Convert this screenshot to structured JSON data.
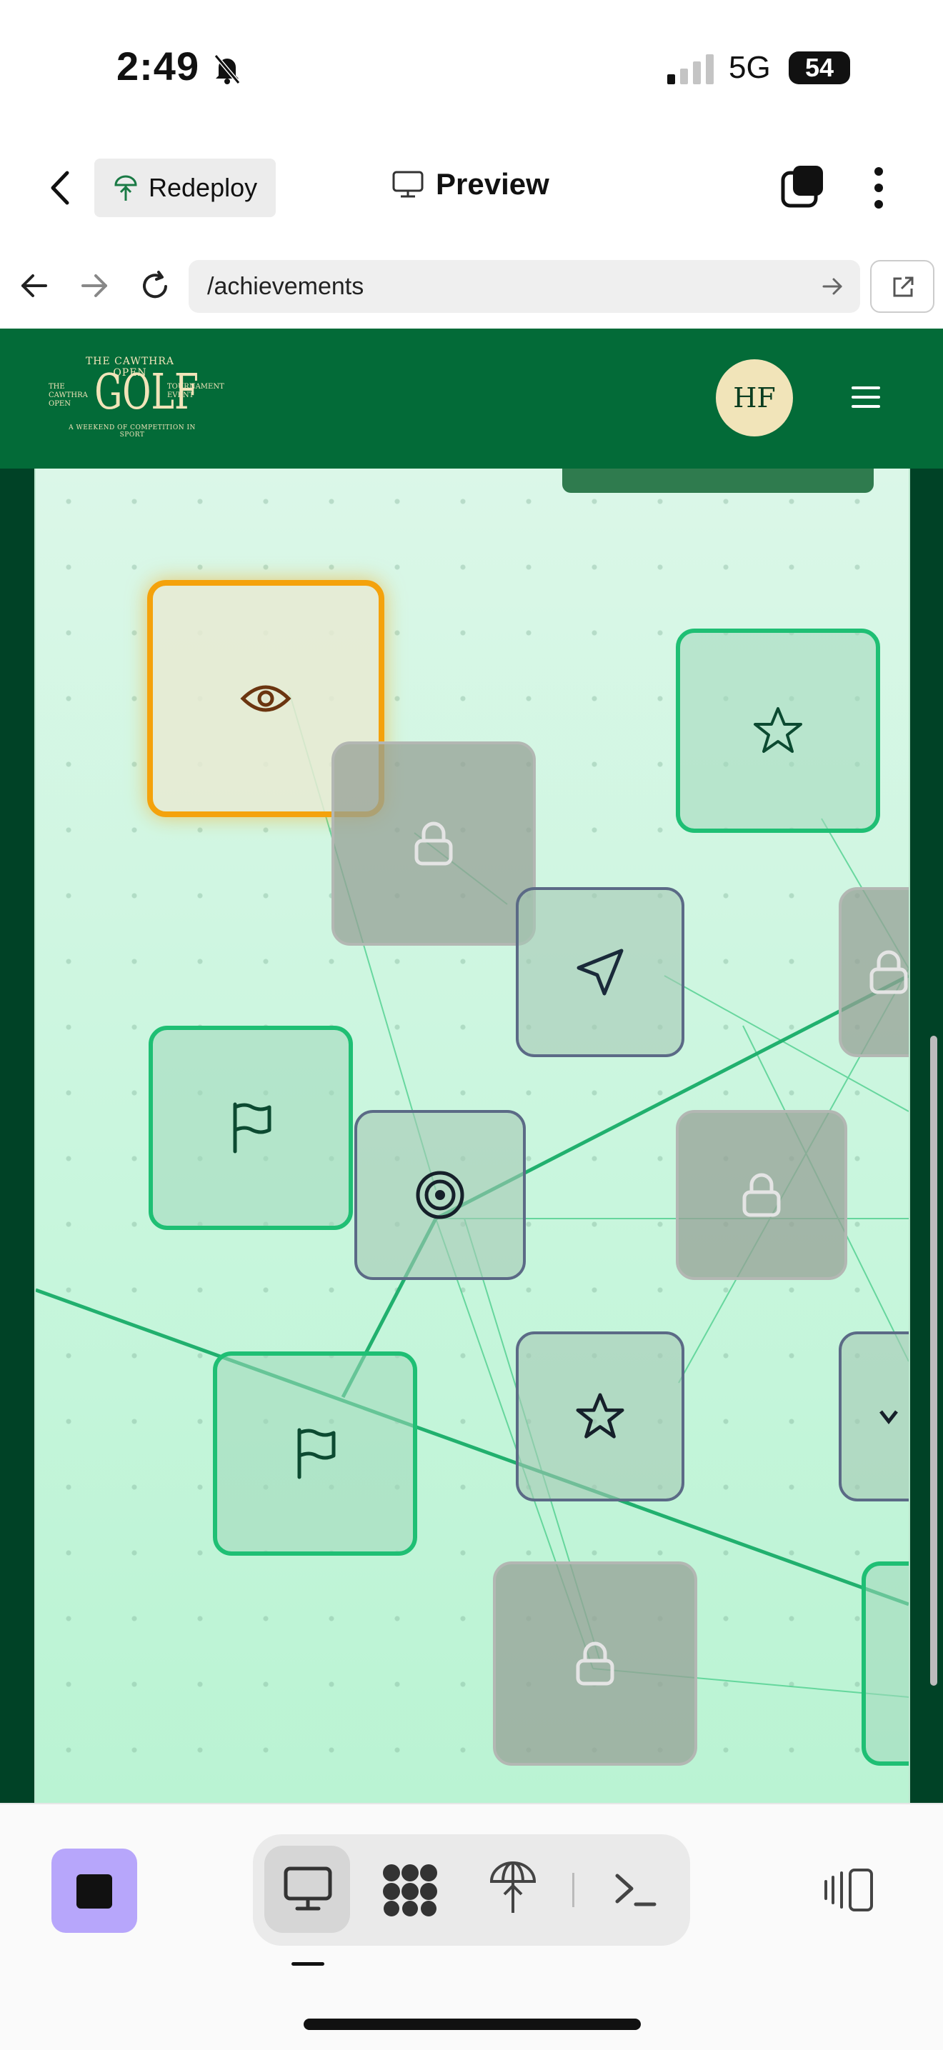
{
  "status_bar": {
    "time": "2:49",
    "network": "5G",
    "battery": "54"
  },
  "app_header": {
    "back_icon": "chevron-left-icon",
    "redeploy_label": "Redeploy",
    "preview_label": "Preview"
  },
  "browser": {
    "url": "/achievements"
  },
  "site": {
    "logo": {
      "line1": "THE CAWTHRA OPEN",
      "main": "GOLF",
      "left": "THE CAWTHRA OPEN",
      "right": "TOURNAMENT EVENT",
      "tagline": "A WEEKEND OF COMPETITION IN SPORT"
    },
    "avatar_initials": "HF"
  },
  "achievement_tiles": [
    {
      "icon": "eye-icon",
      "state": "highlighted"
    },
    {
      "icon": "lock-icon",
      "state": "locked"
    },
    {
      "icon": "star-icon",
      "state": "unlocked"
    },
    {
      "icon": "send-icon",
      "state": "available"
    },
    {
      "icon": "lock-icon",
      "state": "locked"
    },
    {
      "icon": "flag-icon",
      "state": "unlocked"
    },
    {
      "icon": "target-icon",
      "state": "available"
    },
    {
      "icon": "lock-icon",
      "state": "locked"
    },
    {
      "icon": "flag-icon",
      "state": "unlocked"
    },
    {
      "icon": "star-icon",
      "state": "available"
    },
    {
      "icon": "chevron-icon",
      "state": "available"
    },
    {
      "icon": "lock-icon",
      "state": "locked"
    },
    {
      "icon": "unknown-icon",
      "state": "unlocked"
    }
  ],
  "colors": {
    "header_green": "#036b38",
    "unlocked_border": "#1fbf74",
    "highlight_border": "#f4a20c",
    "stop_button": "#b7a6fb"
  },
  "toolbar": {
    "items": [
      "monitor-icon",
      "apps-icon",
      "deploy-icon",
      "terminal-icon"
    ],
    "active": "monitor-icon"
  }
}
